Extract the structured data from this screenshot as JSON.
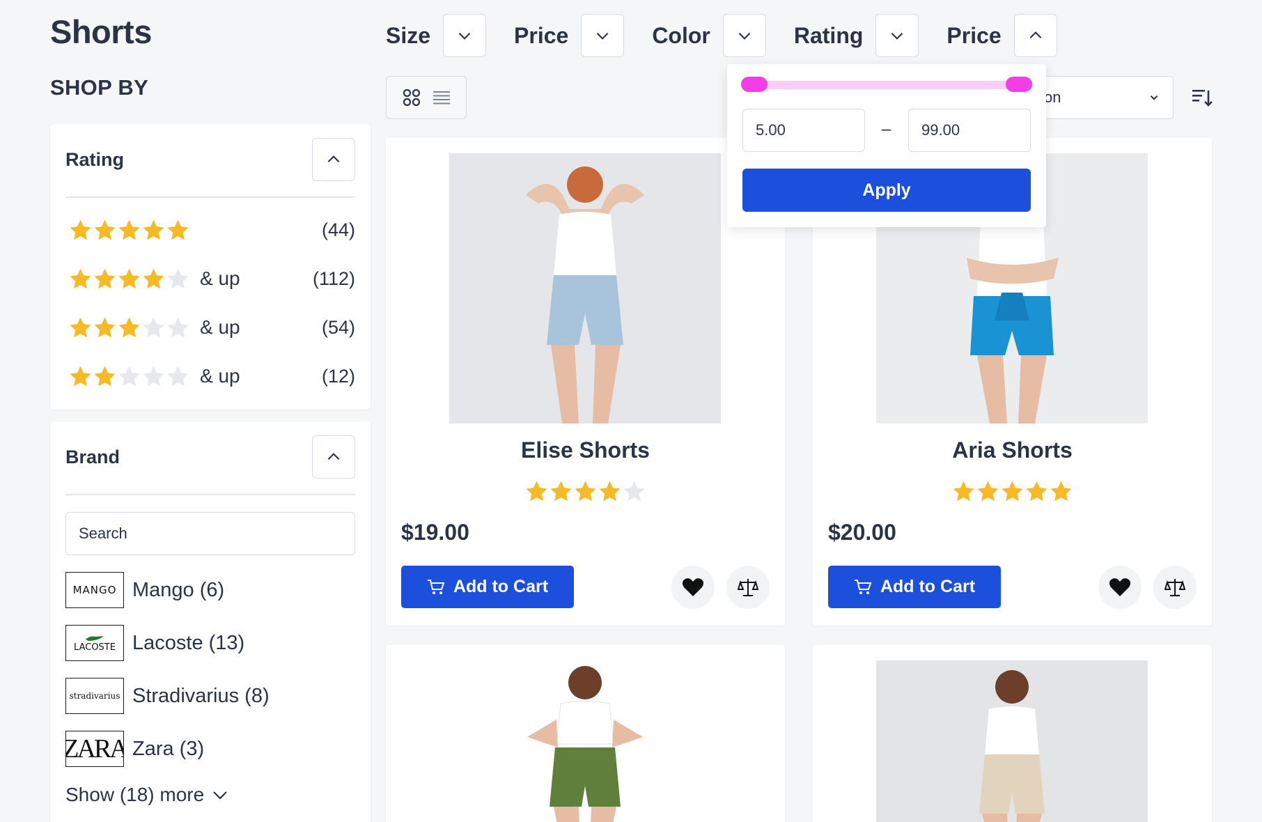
{
  "page": {
    "title": "Shorts",
    "shop_by": "SHOP BY"
  },
  "filters": [
    {
      "label": "Size",
      "expanded": false
    },
    {
      "label": "Price",
      "expanded": false
    },
    {
      "label": "Color",
      "expanded": false
    },
    {
      "label": "Rating",
      "expanded": false
    },
    {
      "label": "Price",
      "expanded": true
    }
  ],
  "sort": {
    "visible_text": "on",
    "icon": "chevron-down-icon",
    "direction_icon": "sort-descending-icon"
  },
  "view_toggle": {
    "grid_icon": "grid-icon",
    "list_icon": "list-icon"
  },
  "price_popup": {
    "min_value": "5.00",
    "max_value": "99.00",
    "apply_label": "Apply"
  },
  "rating_filter": {
    "title": "Rating",
    "rows": [
      {
        "stars": 5,
        "up": "",
        "count": "(44)"
      },
      {
        "stars": 4,
        "up": "& up",
        "count": "(112)"
      },
      {
        "stars": 3,
        "up": "& up",
        "count": "(54)"
      },
      {
        "stars": 2,
        "up": "& up",
        "count": "(12)"
      }
    ]
  },
  "brand_filter": {
    "title": "Brand",
    "search_placeholder": "Search",
    "brands": [
      {
        "logo_text": "MANGO",
        "label": "Mango (6)"
      },
      {
        "logo_text": "LACOSTE",
        "label": "Lacoste (13)"
      },
      {
        "logo_text": "stradivarius",
        "label": "Stradivarius (8)"
      },
      {
        "logo_text": "ZARA",
        "label": "Zara (3)"
      }
    ],
    "show_more": "Show (18) more"
  },
  "products": [
    {
      "name": "Elise Shorts",
      "rating": 4,
      "price": "$19.00",
      "cart_label": "Add to Cart"
    },
    {
      "name": "Aria Shorts",
      "rating": 5,
      "price": "$20.00",
      "cart_label": "Add to Cart"
    }
  ],
  "colors": {
    "accent_blue": "#1c4fdb",
    "star_gold": "#f7b924",
    "star_empty": "#e6e8ec",
    "slider_pink": "#f23ee6",
    "slider_track": "#fbcdf5"
  }
}
